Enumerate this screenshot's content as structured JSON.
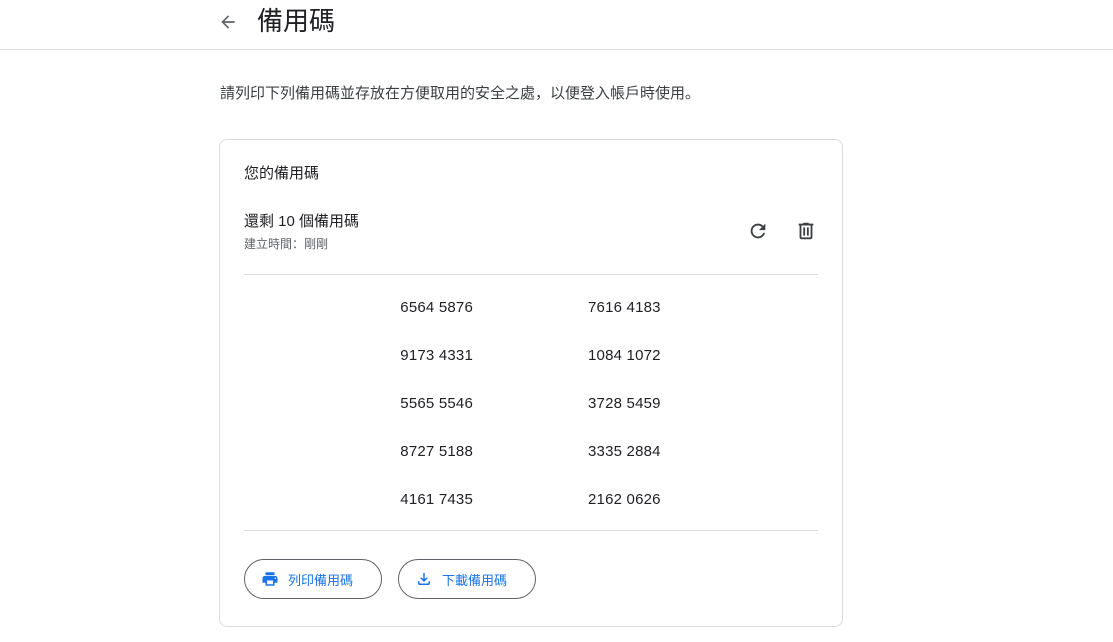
{
  "header": {
    "title": "備用碼",
    "back_icon": "arrow-left-icon"
  },
  "description": "請列印下列備用碼並存放在方便取用的安全之處，以便登入帳戶時使用。",
  "card": {
    "title": "您的備用碼",
    "remaining": "還剩 10 個備用碼",
    "created": "建立時間：剛剛",
    "refresh_icon": "refresh-icon",
    "delete_icon": "trash-icon",
    "codes": [
      {
        "left": "6564 5876",
        "right": "7616 4183"
      },
      {
        "left": "9173 4331",
        "right": "1084 1072"
      },
      {
        "left": "5565 5546",
        "right": "3728 5459"
      },
      {
        "left": "8727 5188",
        "right": "3335 2884"
      },
      {
        "left": "4161 7435",
        "right": "2162 0626"
      }
    ],
    "print_label": "列印備用碼",
    "download_label": "下載備用碼"
  },
  "colors": {
    "accent": "#1a73e8",
    "border": "#dadce0",
    "text": "#202124",
    "secondary_text": "#5f6368"
  }
}
